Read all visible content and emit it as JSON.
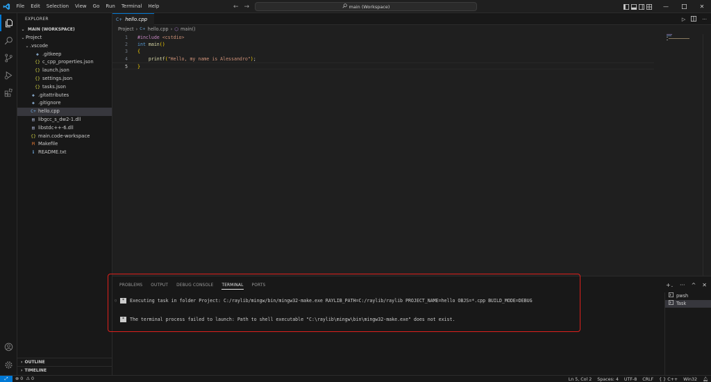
{
  "menu": [
    "File",
    "Edit",
    "Selection",
    "View",
    "Go",
    "Run",
    "Terminal",
    "Help"
  ],
  "search": {
    "text": "main (Workspace)"
  },
  "sidebar": {
    "title": "EXPLORER",
    "workspace": "MAIN (WORKSPACE)",
    "tree": [
      {
        "label": "Project",
        "indent": 0,
        "chevron": "⌄",
        "icon": "",
        "icon_color": "#cccccc",
        "selected": false
      },
      {
        "label": ".vscode",
        "indent": 1,
        "chevron": "⌄",
        "icon": "",
        "icon_color": "#cccccc",
        "selected": false
      },
      {
        "label": ".gitkeep",
        "indent": 2,
        "chevron": "",
        "icon": "◆",
        "icon_color": "#7f9fbf",
        "selected": false
      },
      {
        "label": "c_cpp_properties.json",
        "indent": 2,
        "chevron": "",
        "icon": "{}",
        "icon_color": "#cbcb41",
        "selected": false
      },
      {
        "label": "launch.json",
        "indent": 2,
        "chevron": "",
        "icon": "{}",
        "icon_color": "#cbcb41",
        "selected": false
      },
      {
        "label": "settings.json",
        "indent": 2,
        "chevron": "",
        "icon": "{}",
        "icon_color": "#cbcb41",
        "selected": false
      },
      {
        "label": "tasks.json",
        "indent": 2,
        "chevron": "",
        "icon": "{}",
        "icon_color": "#cbcb41",
        "selected": false
      },
      {
        "label": ".gitattributes",
        "indent": 1,
        "chevron": "",
        "icon": "◆",
        "icon_color": "#7f9fbf",
        "selected": false
      },
      {
        "label": ".gitignore",
        "indent": 1,
        "chevron": "",
        "icon": "◆",
        "icon_color": "#7f9fbf",
        "selected": false
      },
      {
        "label": "hello.cpp",
        "indent": 1,
        "chevron": "",
        "icon": "C+",
        "icon_color": "#6fa8dc",
        "selected": true
      },
      {
        "label": "libgcc_s_dw2-1.dll",
        "indent": 1,
        "chevron": "",
        "icon": "▤",
        "icon_color": "#9fa8c5",
        "selected": false
      },
      {
        "label": "libstdc++-6.dll",
        "indent": 1,
        "chevron": "",
        "icon": "▤",
        "icon_color": "#9fa8c5",
        "selected": false
      },
      {
        "label": "main.code-workspace",
        "indent": 1,
        "chevron": "",
        "icon": "{}",
        "icon_color": "#cbcb41",
        "selected": false
      },
      {
        "label": "Makefile",
        "indent": 1,
        "chevron": "",
        "icon": "M",
        "icon_color": "#e37933",
        "selected": false
      },
      {
        "label": "README.txt",
        "indent": 1,
        "chevron": "",
        "icon": "ℹ",
        "icon_color": "#6fa8dc",
        "selected": false
      }
    ],
    "outline": "OUTLINE",
    "timeline": "TIMELINE"
  },
  "editor": {
    "tab": "hello.cpp",
    "breadcrumb": [
      "Project",
      "hello.cpp",
      "main()"
    ],
    "lines": [
      {
        "num": "1",
        "tokens": [
          {
            "t": "#include ",
            "c": "kw"
          },
          {
            "t": "<cstdio>",
            "c": "inc"
          }
        ]
      },
      {
        "num": "2",
        "tokens": [
          {
            "t": "int ",
            "c": "ty"
          },
          {
            "t": "main",
            "c": "fn"
          },
          {
            "t": "()",
            "c": "br"
          }
        ]
      },
      {
        "num": "3",
        "tokens": [
          {
            "t": "{",
            "c": "br"
          }
        ]
      },
      {
        "num": "4",
        "tokens": [
          {
            "t": "    ",
            "c": ""
          },
          {
            "t": "printf",
            "c": "fn"
          },
          {
            "t": "(",
            "c": "br"
          },
          {
            "t": "\"Hello, my name is Alessandro\"",
            "c": "str"
          },
          {
            "t": ")",
            "c": "br"
          },
          {
            "t": ";",
            "c": ""
          }
        ]
      },
      {
        "num": "5",
        "tokens": [
          {
            "t": "}",
            "c": "br"
          }
        ]
      }
    ]
  },
  "panel": {
    "tabs": [
      "PROBLEMS",
      "OUTPUT",
      "DEBUG CONSOLE",
      "TERMINAL",
      "PORTS"
    ],
    "active_tab": "TERMINAL",
    "terminal_lines": [
      "Executing task in folder Project: C:/raylib/mingw/bin/mingw32-make.exe RAYLIB_PATH=C:/raylib/raylib PROJECT_NAME=hello OBJS=*.cpp BUILD_MODE=DEBUG",
      "The terminal process failed to launch: Path to shell executable \"C:\\raylib\\mingw\\bin\\mingw32-make.exe\" does not exist."
    ],
    "terminals": [
      {
        "label": "pwsh",
        "active": false
      },
      {
        "label": "Task",
        "active": true
      }
    ]
  },
  "status": {
    "errors": "0",
    "warnings": "0",
    "position": "Ln 5, Col 2",
    "spaces": "Spaces: 4",
    "encoding": "UTF-8",
    "eol": "CRLF",
    "language": "C++",
    "platform": "Win32"
  }
}
